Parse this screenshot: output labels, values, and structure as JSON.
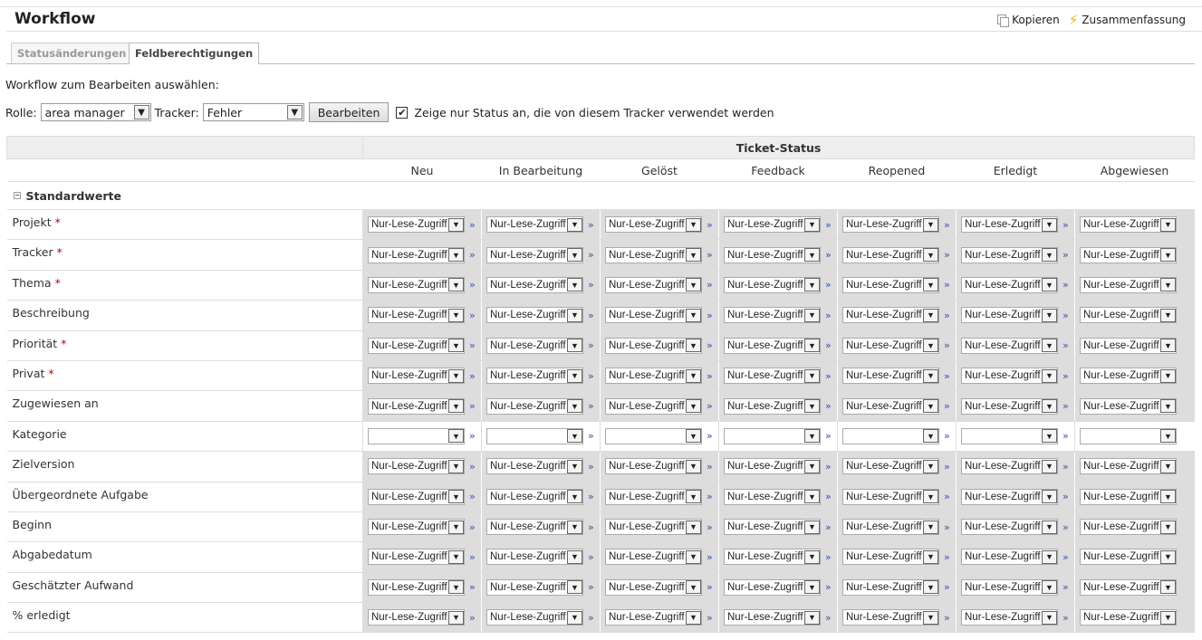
{
  "header": {
    "title": "Workflow",
    "copy_label": "Kopieren",
    "summary_label": "Zusammenfassung"
  },
  "tabs": [
    {
      "label": "Statusänderungen",
      "active": false
    },
    {
      "label": "Feldberechtigungen",
      "active": true
    }
  ],
  "prompt": "Workflow zum Bearbeiten auswählen:",
  "filter": {
    "role_label": "Rolle:",
    "role_value": "area manager",
    "tracker_label": "Tracker:",
    "tracker_value": "Fehler",
    "edit_button": "Bearbeiten",
    "only_used_checked": true,
    "only_used_label": "Zeige nur Status an, die von diesem Tracker verwendet werden"
  },
  "table": {
    "status_header": "Ticket-Status",
    "statuses": [
      "Neu",
      "In Bearbeitung",
      "Gelöst",
      "Feedback",
      "Reopened",
      "Erledigt",
      "Abgewiesen"
    ],
    "group_label": "Standardwerte",
    "option_readonly": "Nur-Lese-Zugriff",
    "rows": [
      {
        "label": "Projekt",
        "required": true,
        "value": "Nur-Lese-Zugriff"
      },
      {
        "label": "Tracker",
        "required": true,
        "value": "Nur-Lese-Zugriff"
      },
      {
        "label": "Thema",
        "required": true,
        "value": "Nur-Lese-Zugriff"
      },
      {
        "label": "Beschreibung",
        "required": false,
        "value": "Nur-Lese-Zugriff"
      },
      {
        "label": "Priorität",
        "required": true,
        "value": "Nur-Lese-Zugriff"
      },
      {
        "label": "Privat",
        "required": true,
        "value": "Nur-Lese-Zugriff"
      },
      {
        "label": "Zugewiesen an",
        "required": false,
        "value": "Nur-Lese-Zugriff"
      },
      {
        "label": "Kategorie",
        "required": false,
        "value": ""
      },
      {
        "label": "Zielversion",
        "required": false,
        "value": "Nur-Lese-Zugriff"
      },
      {
        "label": "Übergeordnete Aufgabe",
        "required": false,
        "value": "Nur-Lese-Zugriff"
      },
      {
        "label": "Beginn",
        "required": false,
        "value": "Nur-Lese-Zugriff"
      },
      {
        "label": "Abgabedatum",
        "required": false,
        "value": "Nur-Lese-Zugriff"
      },
      {
        "label": "Geschätzter Aufwand",
        "required": false,
        "value": "Nur-Lese-Zugriff"
      },
      {
        "label": "% erledigt",
        "required": false,
        "value": "Nur-Lese-Zugriff"
      }
    ]
  }
}
